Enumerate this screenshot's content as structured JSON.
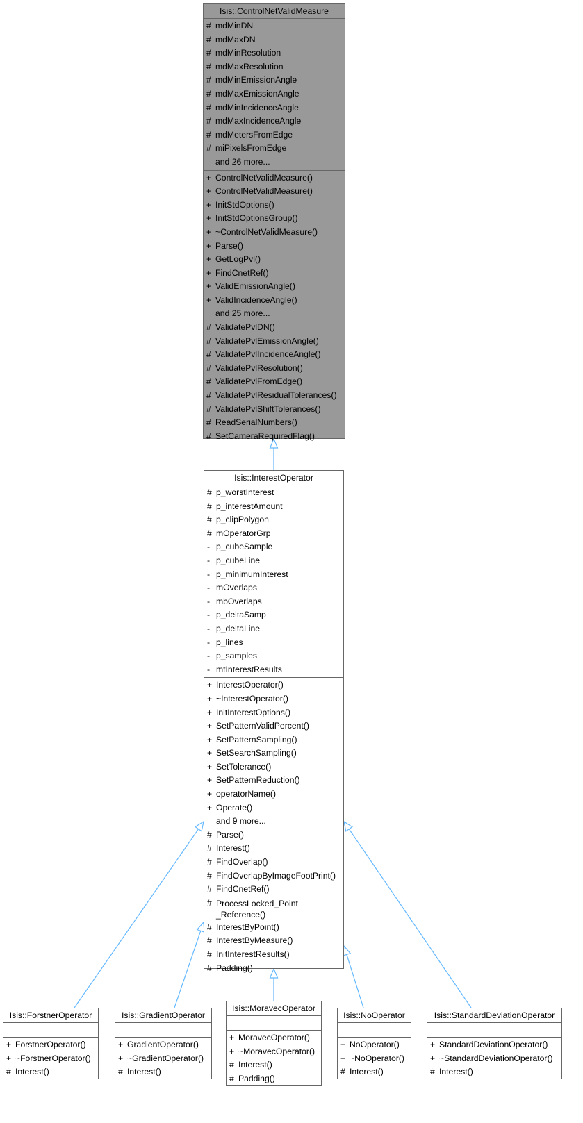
{
  "diagram": {
    "type": "class-inheritance",
    "edge_color": "#63b8ff",
    "highlight_fill": "#999999",
    "classes": [
      {
        "id": "ControlNetValidMeasure",
        "title": "Isis::ControlNetValidMeasure",
        "highlighted": true,
        "attributes": [
          {
            "vis": "#",
            "name": "mdMinDN"
          },
          {
            "vis": "#",
            "name": "mdMaxDN"
          },
          {
            "vis": "#",
            "name": "mdMinResolution"
          },
          {
            "vis": "#",
            "name": "mdMaxResolution"
          },
          {
            "vis": "#",
            "name": "mdMinEmissionAngle"
          },
          {
            "vis": "#",
            "name": "mdMaxEmissionAngle"
          },
          {
            "vis": "#",
            "name": "mdMinIncidenceAngle"
          },
          {
            "vis": "#",
            "name": "mdMaxIncidenceAngle"
          },
          {
            "vis": "#",
            "name": "mdMetersFromEdge"
          },
          {
            "vis": "#",
            "name": "miPixelsFromEdge"
          },
          {
            "vis": "",
            "name": "and 26 more..."
          }
        ],
        "methods": [
          {
            "vis": "+",
            "name": "ControlNetValidMeasure()"
          },
          {
            "vis": "+",
            "name": "ControlNetValidMeasure()"
          },
          {
            "vis": "+",
            "name": "InitStdOptions()"
          },
          {
            "vis": "+",
            "name": "InitStdOptionsGroup()"
          },
          {
            "vis": "+",
            "name": "~ControlNetValidMeasure()"
          },
          {
            "vis": "+",
            "name": "Parse()"
          },
          {
            "vis": "+",
            "name": "GetLogPvl()"
          },
          {
            "vis": "+",
            "name": "FindCnetRef()"
          },
          {
            "vis": "+",
            "name": "ValidEmissionAngle()"
          },
          {
            "vis": "+",
            "name": "ValidIncidenceAngle()"
          },
          {
            "vis": "",
            "name": "and 25 more..."
          },
          {
            "vis": "#",
            "name": "ValidatePvlDN()"
          },
          {
            "vis": "#",
            "name": "ValidatePvlEmissionAngle()"
          },
          {
            "vis": "#",
            "name": "ValidatePvlIncidenceAngle()"
          },
          {
            "vis": "#",
            "name": "ValidatePvlResolution()"
          },
          {
            "vis": "#",
            "name": "ValidatePvlFromEdge()"
          },
          {
            "vis": "#",
            "name": "ValidatePvlResidualTolerances()"
          },
          {
            "vis": "#",
            "name": "ValidatePvlShiftTolerances()"
          },
          {
            "vis": "#",
            "name": "ReadSerialNumbers()"
          },
          {
            "vis": "#",
            "name": "SetCameraRequiredFlag()"
          }
        ]
      },
      {
        "id": "InterestOperator",
        "title": "Isis::InterestOperator",
        "highlighted": false,
        "attributes": [
          {
            "vis": "#",
            "name": "p_worstInterest"
          },
          {
            "vis": "#",
            "name": "p_interestAmount"
          },
          {
            "vis": "#",
            "name": "p_clipPolygon"
          },
          {
            "vis": "#",
            "name": "mOperatorGrp"
          },
          {
            "vis": "-",
            "name": "p_cubeSample"
          },
          {
            "vis": "-",
            "name": "p_cubeLine"
          },
          {
            "vis": "-",
            "name": "p_minimumInterest"
          },
          {
            "vis": "-",
            "name": "mOverlaps"
          },
          {
            "vis": "-",
            "name": "mbOverlaps"
          },
          {
            "vis": "-",
            "name": "p_deltaSamp"
          },
          {
            "vis": "-",
            "name": "p_deltaLine"
          },
          {
            "vis": "-",
            "name": "p_lines"
          },
          {
            "vis": "-",
            "name": "p_samples"
          },
          {
            "vis": "-",
            "name": "mtInterestResults"
          }
        ],
        "methods": [
          {
            "vis": "+",
            "name": "InterestOperator()"
          },
          {
            "vis": "+",
            "name": "~InterestOperator()"
          },
          {
            "vis": "+",
            "name": "InitInterestOptions()"
          },
          {
            "vis": "+",
            "name": "SetPatternValidPercent()"
          },
          {
            "vis": "+",
            "name": "SetPatternSampling()"
          },
          {
            "vis": "+",
            "name": "SetSearchSampling()"
          },
          {
            "vis": "+",
            "name": "SetTolerance()"
          },
          {
            "vis": "+",
            "name": "SetPatternReduction()"
          },
          {
            "vis": "+",
            "name": "operatorName()"
          },
          {
            "vis": "+",
            "name": "Operate()"
          },
          {
            "vis": "",
            "name": "and 9 more..."
          },
          {
            "vis": "#",
            "name": "Parse()"
          },
          {
            "vis": "#",
            "name": "Interest()"
          },
          {
            "vis": "#",
            "name": "FindOverlap()"
          },
          {
            "vis": "#",
            "name": "FindOverlapByImageFootPrint()"
          },
          {
            "vis": "#",
            "name": "FindCnetRef()"
          },
          {
            "vis": "#",
            "name": "ProcessLocked_Point\n_Reference()",
            "wrapped": true
          },
          {
            "vis": "#",
            "name": "InterestByPoint()"
          },
          {
            "vis": "#",
            "name": "InterestByMeasure()"
          },
          {
            "vis": "#",
            "name": "InitInterestResults()"
          },
          {
            "vis": "#",
            "name": "Padding()"
          }
        ]
      },
      {
        "id": "ForstnerOperator",
        "title": "Isis::ForstnerOperator",
        "highlighted": false,
        "attributes": [],
        "methods": [
          {
            "vis": "+",
            "name": "ForstnerOperator()"
          },
          {
            "vis": "+",
            "name": "~ForstnerOperator()"
          },
          {
            "vis": "#",
            "name": "Interest()"
          }
        ]
      },
      {
        "id": "GradientOperator",
        "title": "Isis::GradientOperator",
        "highlighted": false,
        "attributes": [],
        "methods": [
          {
            "vis": "+",
            "name": "GradientOperator()"
          },
          {
            "vis": "+",
            "name": "~GradientOperator()"
          },
          {
            "vis": "#",
            "name": "Interest()"
          }
        ]
      },
      {
        "id": "MoravecOperator",
        "title": "Isis::MoravecOperator",
        "highlighted": false,
        "attributes": [],
        "methods": [
          {
            "vis": "+",
            "name": "MoravecOperator()"
          },
          {
            "vis": "+",
            "name": "~MoravecOperator()"
          },
          {
            "vis": "#",
            "name": "Interest()"
          },
          {
            "vis": "#",
            "name": "Padding()"
          }
        ]
      },
      {
        "id": "NoOperator",
        "title": "Isis::NoOperator",
        "highlighted": false,
        "attributes": [],
        "methods": [
          {
            "vis": "+",
            "name": "NoOperator()"
          },
          {
            "vis": "+",
            "name": "~NoOperator()"
          },
          {
            "vis": "#",
            "name": "Interest()"
          }
        ]
      },
      {
        "id": "StandardDeviationOperator",
        "title": "Isis::StandardDeviationOperator",
        "highlighted": false,
        "attributes": [],
        "methods": [
          {
            "vis": "+",
            "name": "StandardDeviationOperator()"
          },
          {
            "vis": "+",
            "name": "~StandardDeviationOperator()"
          },
          {
            "vis": "#",
            "name": "Interest()"
          }
        ]
      }
    ],
    "edges": [
      {
        "from": "InterestOperator",
        "to": "ControlNetValidMeasure",
        "kind": "inheritance"
      },
      {
        "from": "ForstnerOperator",
        "to": "InterestOperator",
        "kind": "inheritance"
      },
      {
        "from": "GradientOperator",
        "to": "InterestOperator",
        "kind": "inheritance"
      },
      {
        "from": "MoravecOperator",
        "to": "InterestOperator",
        "kind": "inheritance"
      },
      {
        "from": "NoOperator",
        "to": "InterestOperator",
        "kind": "inheritance"
      },
      {
        "from": "StandardDeviationOperator",
        "to": "InterestOperator",
        "kind": "inheritance"
      }
    ]
  }
}
